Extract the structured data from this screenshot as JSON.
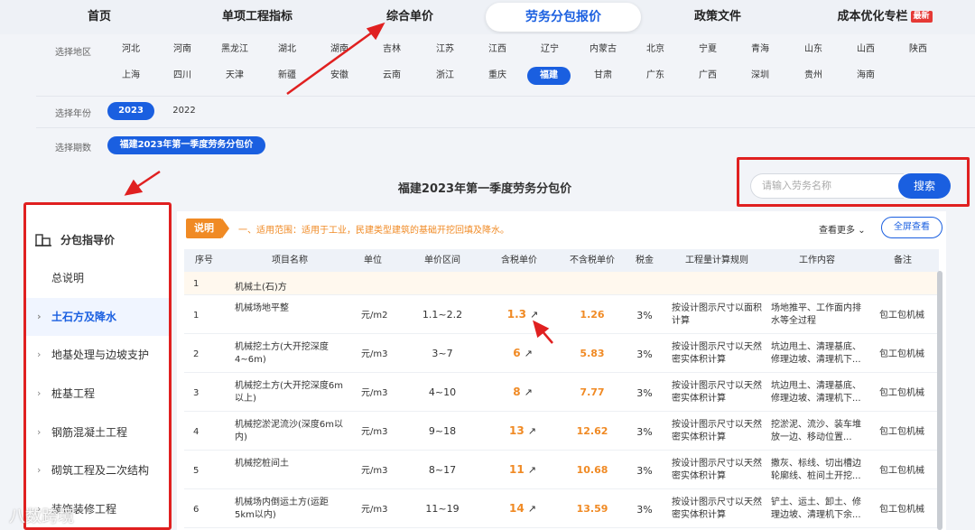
{
  "nav": {
    "items": [
      "首页",
      "单项工程指标",
      "综合单价",
      "劳务分包报价",
      "政策文件",
      "成本优化专栏"
    ],
    "new_badge": "最新"
  },
  "filters": {
    "region_label": "选择地区",
    "regions_row1": [
      "河北",
      "河南",
      "黑龙江",
      "湖北",
      "湖南",
      "吉林",
      "江苏",
      "江西",
      "辽宁",
      "内蒙古",
      "北京",
      "宁夏",
      "青海",
      "山东",
      "山西",
      "陕西"
    ],
    "regions_row2": [
      "上海",
      "四川",
      "天津",
      "新疆",
      "安徽",
      "云南",
      "浙江",
      "重庆",
      "福建",
      "甘肃",
      "广东",
      "广西",
      "深圳",
      "贵州",
      "海南"
    ],
    "selected_region": "福建",
    "year_label": "选择年份",
    "years": [
      "2023",
      "2022"
    ],
    "period_label": "选择期数",
    "period": "福建2023年第一季度劳务分包价"
  },
  "sidebar": {
    "title": "分包指导价",
    "items": [
      "总说明",
      "土石方及降水",
      "地基处理与边坡支护",
      "桩基工程",
      "钢筋混凝土工程",
      "砌筑工程及二次结构",
      "装饰装修工程"
    ]
  },
  "main": {
    "title": "福建2023年第一季度劳务分包价",
    "search_placeholder": "请输入劳务名称",
    "search_button": "搜索",
    "explain_tag": "说明",
    "explain_text": "一、适用范围：适用于工业，民建类型建筑的基础开挖回填及降水。",
    "more": "查看更多",
    "fullscreen": "全屏查看"
  },
  "table": {
    "headers": [
      "序号",
      "项目名称",
      "单位",
      "单价区间",
      "含税单价",
      "不含税单价",
      "税金",
      "工程量计算规则",
      "工作内容",
      "备注"
    ],
    "group": {
      "no": "1",
      "name": "机械土(石)方"
    },
    "rows": [
      {
        "no": "1",
        "name": "机械场地平整",
        "unit": "元/m2",
        "range": "1.1~2.2",
        "tax_price": "1.3",
        "price": "1.26",
        "tax": "3%",
        "rule": "按设计图示尺寸以面积计算",
        "work": "场地推平、工作面内排水等全过程",
        "note": "包工包机械"
      },
      {
        "no": "2",
        "name": "机械挖土方(大开挖深度4~6m)",
        "unit": "元/m3",
        "range": "3~7",
        "tax_price": "6",
        "price": "5.83",
        "tax": "3%",
        "rule": "按设计图示尺寸以天然密实体积计算",
        "work": "坑边甩土、清理基底、修理边坡、清理机下...",
        "note": "包工包机械"
      },
      {
        "no": "3",
        "name": "机械挖土方(大开挖深度6m以上)",
        "unit": "元/m3",
        "range": "4~10",
        "tax_price": "8",
        "price": "7.77",
        "tax": "3%",
        "rule": "按设计图示尺寸以天然密实体积计算",
        "work": "坑边甩土、清理基底、修理边坡、清理机下...",
        "note": "包工包机械"
      },
      {
        "no": "4",
        "name": "机械挖淤泥流沙(深度6m以内)",
        "unit": "元/m3",
        "range": "9~18",
        "tax_price": "13",
        "price": "12.62",
        "tax": "3%",
        "rule": "按设计图示尺寸以天然密实体积计算",
        "work": "挖淤泥、流沙、装车堆放一边、移动位置...",
        "note": "包工包机械"
      },
      {
        "no": "5",
        "name": "机械挖桩间土",
        "unit": "元/m3",
        "range": "8~17",
        "tax_price": "11",
        "price": "10.68",
        "tax": "3%",
        "rule": "按设计图示尺寸以天然密实体积计算",
        "work": "撒灰、标线、切出槽边轮廓线、桩间土开挖...",
        "note": "包工包机械"
      },
      {
        "no": "6",
        "name": "机械场内倒运土方(运距5km以内)",
        "unit": "元/m3",
        "range": "11~19",
        "tax_price": "14",
        "price": "13.59",
        "tax": "3%",
        "rule": "按设计图示尺寸以天然密实体积计算",
        "work": "铲土、运土、卸土、修理边坡、清理机下余...",
        "note": "包工包机械"
      }
    ]
  },
  "watermark": "八数跨境",
  "colors": {
    "accent": "#1a5fe0",
    "orange": "#f08a24",
    "highlight_red": "#e02020"
  }
}
